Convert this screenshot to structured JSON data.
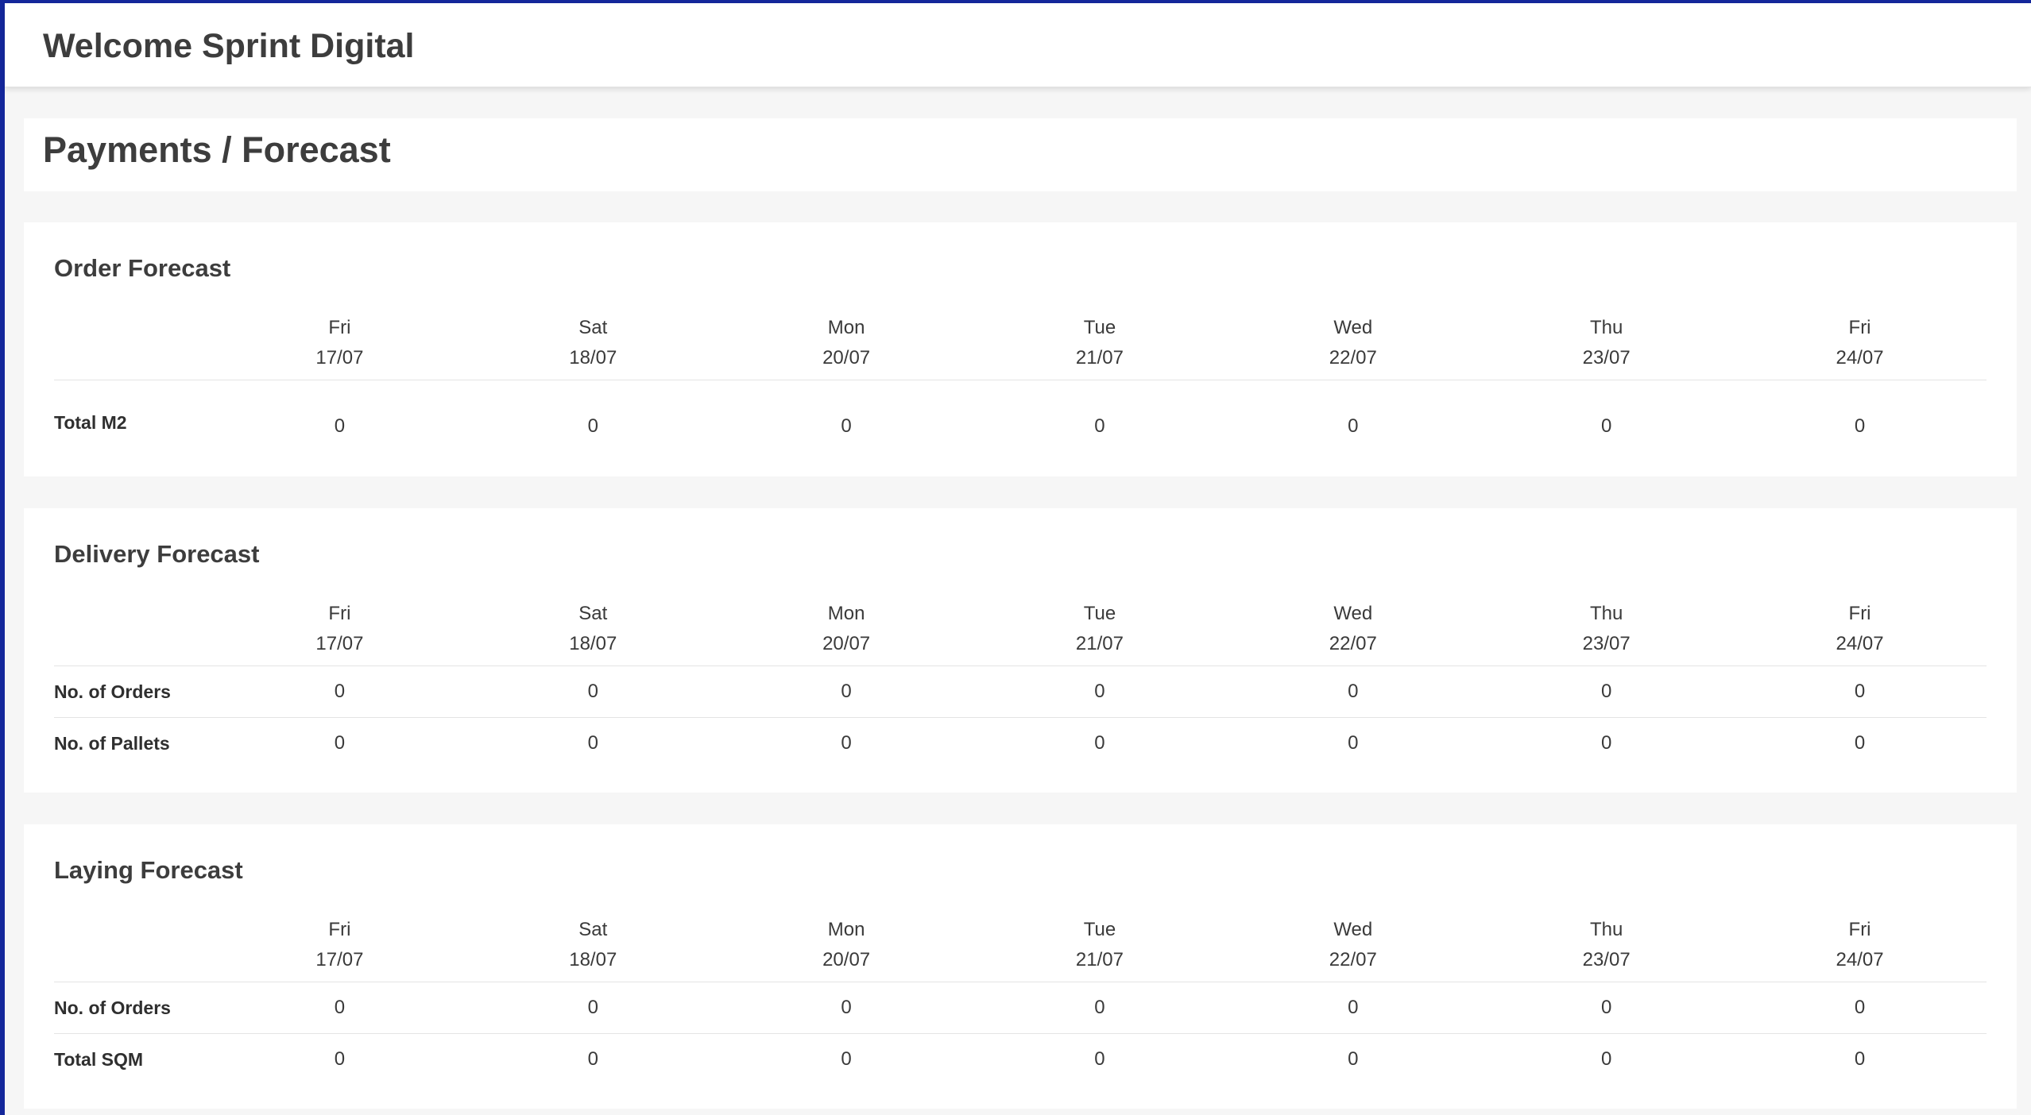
{
  "app": {
    "welcome_title": "Welcome Sprint Digital"
  },
  "page": {
    "title": "Payments / Forecast"
  },
  "days": [
    {
      "name": "Fri",
      "date": "17/07"
    },
    {
      "name": "Sat",
      "date": "18/07"
    },
    {
      "name": "Mon",
      "date": "20/07"
    },
    {
      "name": "Tue",
      "date": "21/07"
    },
    {
      "name": "Wed",
      "date": "22/07"
    },
    {
      "name": "Thu",
      "date": "23/07"
    },
    {
      "name": "Fri",
      "date": "24/07"
    }
  ],
  "order_forecast": {
    "title": "Order Forecast",
    "rows": [
      {
        "label": "Total M2",
        "values": [
          "0",
          "0",
          "0",
          "0",
          "0",
          "0",
          "0"
        ]
      }
    ]
  },
  "delivery_forecast": {
    "title": "Delivery Forecast",
    "rows": [
      {
        "label": "No. of Orders",
        "values": [
          "0",
          "0",
          "0",
          "0",
          "0",
          "0",
          "0"
        ]
      },
      {
        "label": "No. of Pallets",
        "values": [
          "0",
          "0",
          "0",
          "0",
          "0",
          "0",
          "0"
        ]
      }
    ]
  },
  "laying_forecast": {
    "title": "Laying Forecast",
    "rows": [
      {
        "label": "No. of Orders",
        "values": [
          "0",
          "0",
          "0",
          "0",
          "0",
          "0",
          "0"
        ]
      },
      {
        "label": "Total SQM",
        "values": [
          "0",
          "0",
          "0",
          "0",
          "0",
          "0",
          "0"
        ]
      }
    ]
  },
  "colors": {
    "frame_accent": "#14279b",
    "card_bg": "#ffffff",
    "page_bg": "#f6f6f6"
  }
}
